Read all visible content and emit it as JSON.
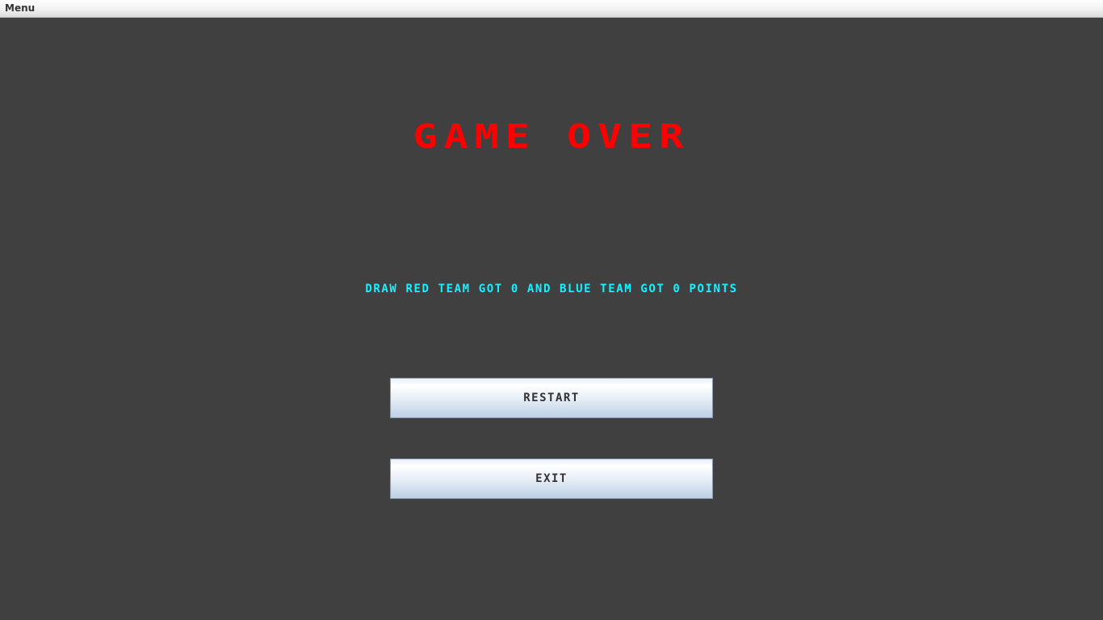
{
  "menubar": {
    "menu_label": "Menu"
  },
  "game_over": {
    "title": "GAME OVER",
    "result_text": "DRAW RED TEAM GOT 0 AND BLUE TEAM GOT 0 POINTS",
    "restart_label": "RESTART",
    "exit_label": "EXIT"
  },
  "colors": {
    "background": "#404040",
    "title": "#ff0000",
    "result_text": "#18f0ff",
    "button_text": "#333333"
  }
}
